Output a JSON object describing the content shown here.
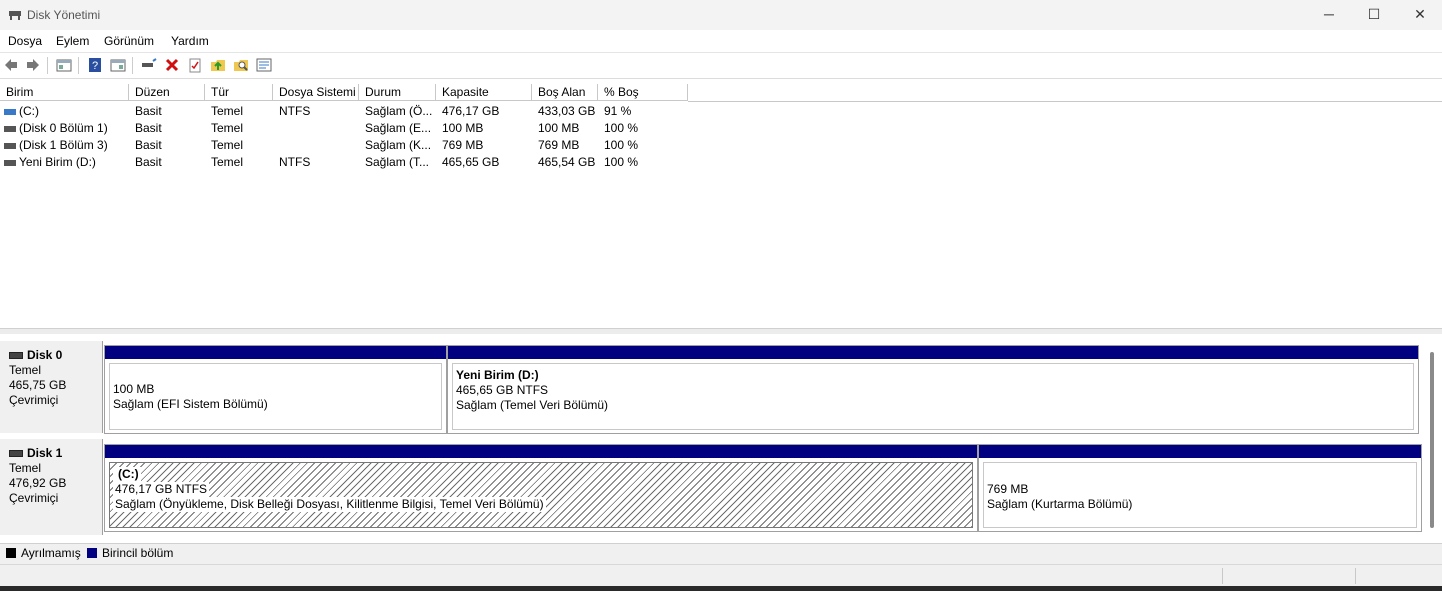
{
  "window": {
    "title": "Disk Yönetimi",
    "minimize_glyph": "─",
    "maximize_glyph": "☐",
    "close_glyph": "✕"
  },
  "menu": [
    "Dosya",
    "Eylem",
    "Görünüm",
    "Yardım"
  ],
  "toolbar": {
    "icons": [
      "back-icon",
      "forward-icon",
      "console-tree-icon",
      "help-icon",
      "action-pane-icon",
      "connect-drive-icon",
      "delete-icon",
      "properties-icon",
      "new-folder-icon",
      "search-icon",
      "view-icon"
    ],
    "accent_colors": {
      "delete": "#d01010",
      "help": "#2a4fa0"
    }
  },
  "table": {
    "columns": [
      "Birim",
      "Düzen",
      "Tür",
      "Dosya Sistemi",
      "Durum",
      "Kapasite",
      "Boş Alan",
      "% Boş"
    ],
    "rows": [
      [
        "(C:)",
        "Basit",
        "Temel",
        "NTFS",
        "Sağlam (Ö...",
        "476,17 GB",
        "433,03 GB",
        "91 %"
      ],
      [
        "(Disk 0 Bölüm 1)",
        "Basit",
        "Temel",
        "",
        "Sağlam (E...",
        "100 MB",
        "100 MB",
        "100 %"
      ],
      [
        "(Disk 1 Bölüm 3)",
        "Basit",
        "Temel",
        "",
        "Sağlam (K...",
        "769 MB",
        "769 MB",
        "100 %"
      ],
      [
        "Yeni Birim (D:)",
        "Basit",
        "Temel",
        "NTFS",
        "Sağlam (T...",
        "465,65 GB",
        "465,54 GB",
        "100 %"
      ]
    ]
  },
  "disks": [
    {
      "name": "Disk 0",
      "type": "Temel",
      "size": "465,75 GB",
      "status": "Çevrimiçi",
      "partitions": [
        {
          "title": "",
          "size": "100 MB",
          "status": "Sağlam (EFI Sistem Bölümü)"
        },
        {
          "title": "Yeni Birim  (D:)",
          "size": "465,65 GB NTFS",
          "status": "Sağlam (Temel Veri Bölümü)"
        }
      ]
    },
    {
      "name": "Disk 1",
      "type": "Temel",
      "size": "476,92 GB",
      "status": "Çevrimiçi",
      "partitions": [
        {
          "title": "(C:)",
          "size": "476,17 GB NTFS",
          "status": "Sağlam (Önyükleme, Disk Belleği Dosyası, Kilitlenme Bilgisi, Temel Veri Bölümü)"
        },
        {
          "title": "",
          "size": "769 MB",
          "status": "Sağlam (Kurtarma Bölümü)"
        }
      ]
    }
  ],
  "legend": [
    {
      "label": "Ayrılmamış",
      "color": "#000000"
    },
    {
      "label": "Birincil bölüm",
      "color": "#000080"
    }
  ],
  "colors": {
    "partition_bar": "#000080",
    "system_volume_icon": "#3a78c8",
    "volume_icon": "#555555"
  }
}
